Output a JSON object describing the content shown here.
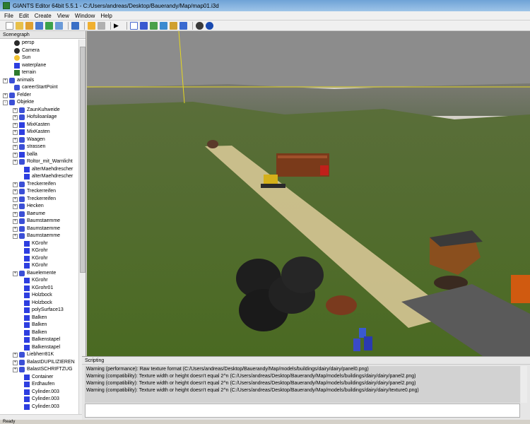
{
  "window": {
    "title": "GIANTS Editor 64bit 5.5.1 - C:/Users/andreas/Desktop/Bauerandy/Map/map01.i3d"
  },
  "menu": [
    "File",
    "Edit",
    "Create",
    "View",
    "Window",
    "Help"
  ],
  "scenegraph": {
    "header": "Scenegraph",
    "items": [
      {
        "label": "persp",
        "depth": 1,
        "icon": "camera-icon",
        "expander": ""
      },
      {
        "label": "Camera",
        "depth": 1,
        "icon": "camera-icon",
        "expander": ""
      },
      {
        "label": "Sun",
        "depth": 1,
        "icon": "sun-icon",
        "expander": ""
      },
      {
        "label": "waterplane",
        "depth": 1,
        "icon": "shape-icon",
        "expander": ""
      },
      {
        "label": "terrain",
        "depth": 1,
        "icon": "terrain-icon",
        "expander": ""
      },
      {
        "label": "animals",
        "depth": 0,
        "icon": "transform-group-icon",
        "expander": "+"
      },
      {
        "label": "careerStartPoint",
        "depth": 1,
        "icon": "transform-group-icon",
        "expander": ""
      },
      {
        "label": "Felder",
        "depth": 0,
        "icon": "transform-group-icon",
        "expander": "+"
      },
      {
        "label": "Objekte",
        "depth": 0,
        "icon": "transform-group-icon",
        "expander": "-"
      },
      {
        "label": "ZaunKuhweide",
        "depth": 2,
        "icon": "transform-group-icon",
        "expander": "+"
      },
      {
        "label": "Hofsiloanlage",
        "depth": 2,
        "icon": "transform-group-icon",
        "expander": "+"
      },
      {
        "label": "MixKasten",
        "depth": 2,
        "icon": "shape-icon",
        "expander": "+"
      },
      {
        "label": "MixKasten",
        "depth": 2,
        "icon": "shape-icon",
        "expander": "+"
      },
      {
        "label": "Waagen",
        "depth": 2,
        "icon": "transform-group-icon",
        "expander": "+"
      },
      {
        "label": "strassen",
        "depth": 2,
        "icon": "transform-group-icon",
        "expander": "+"
      },
      {
        "label": "balla",
        "depth": 2,
        "icon": "shape-icon",
        "expander": "+"
      },
      {
        "label": "Roltor_mit_Warnlicht",
        "depth": 2,
        "icon": "transform-group-icon",
        "expander": "+"
      },
      {
        "label": "alterMaehdrescher",
        "depth": 3,
        "icon": "shape-icon",
        "expander": ""
      },
      {
        "label": "alterMaehdrescher",
        "depth": 3,
        "icon": "shape-icon",
        "expander": ""
      },
      {
        "label": "Treckerreifen",
        "depth": 2,
        "icon": "transform-group-icon",
        "expander": "+"
      },
      {
        "label": "Treckerreifen",
        "depth": 2,
        "icon": "transform-group-icon",
        "expander": "+"
      },
      {
        "label": "Treckerreifen",
        "depth": 2,
        "icon": "transform-group-icon",
        "expander": "+"
      },
      {
        "label": "Hecken",
        "depth": 2,
        "icon": "transform-group-icon",
        "expander": "+"
      },
      {
        "label": "Baeume",
        "depth": 2,
        "icon": "transform-group-icon",
        "expander": "+"
      },
      {
        "label": "Baumstaemme",
        "depth": 2,
        "icon": "transform-group-icon",
        "expander": "+"
      },
      {
        "label": "Baumstaemme",
        "depth": 2,
        "icon": "transform-group-icon",
        "expander": "+"
      },
      {
        "label": "Baumstaemme",
        "depth": 2,
        "icon": "transform-group-icon",
        "expander": "+"
      },
      {
        "label": "KGrohr",
        "depth": 3,
        "icon": "shape-icon",
        "expander": ""
      },
      {
        "label": "KGrohr",
        "depth": 3,
        "icon": "shape-icon",
        "expander": ""
      },
      {
        "label": "KGrohr",
        "depth": 3,
        "icon": "shape-icon",
        "expander": ""
      },
      {
        "label": "KGrohr",
        "depth": 3,
        "icon": "shape-icon",
        "expander": ""
      },
      {
        "label": "Bauelemente",
        "depth": 2,
        "icon": "transform-group-icon",
        "expander": "+"
      },
      {
        "label": "KGrohr",
        "depth": 3,
        "icon": "shape-icon",
        "expander": ""
      },
      {
        "label": "KGrohr01",
        "depth": 3,
        "icon": "shape-icon",
        "expander": ""
      },
      {
        "label": "Holzbock",
        "depth": 3,
        "icon": "shape-icon",
        "expander": ""
      },
      {
        "label": "Holzbock",
        "depth": 3,
        "icon": "shape-icon",
        "expander": ""
      },
      {
        "label": "polySurface13",
        "depth": 3,
        "icon": "shape-icon",
        "expander": ""
      },
      {
        "label": "Balken",
        "depth": 3,
        "icon": "shape-icon",
        "expander": ""
      },
      {
        "label": "Balken",
        "depth": 3,
        "icon": "shape-icon",
        "expander": ""
      },
      {
        "label": "Balken",
        "depth": 3,
        "icon": "shape-icon",
        "expander": ""
      },
      {
        "label": "Balkenstapel",
        "depth": 3,
        "icon": "shape-icon",
        "expander": ""
      },
      {
        "label": "Balkenstapel",
        "depth": 3,
        "icon": "shape-icon",
        "expander": ""
      },
      {
        "label": "Liebherr81K",
        "depth": 2,
        "icon": "transform-group-icon",
        "expander": "+"
      },
      {
        "label": "BalastDUPILIZIEREN",
        "depth": 2,
        "icon": "transform-group-icon",
        "expander": "+"
      },
      {
        "label": "BalastSCHRIFTZUG",
        "depth": 2,
        "icon": "transform-group-icon",
        "expander": "+"
      },
      {
        "label": "Container",
        "depth": 3,
        "icon": "shape-icon",
        "expander": ""
      },
      {
        "label": "Erdhaufen",
        "depth": 3,
        "icon": "shape-icon",
        "expander": ""
      },
      {
        "label": "Cylinder.003",
        "depth": 3,
        "icon": "shape-icon",
        "expander": ""
      },
      {
        "label": "Cylinder.003",
        "depth": 3,
        "icon": "shape-icon",
        "expander": ""
      },
      {
        "label": "Cylinder.003",
        "depth": 3,
        "icon": "shape-icon",
        "expander": ""
      }
    ]
  },
  "scripting": {
    "header": "Scripting",
    "log": [
      "Warning (performance): Raw texture format (C:/Users/andreas/Desktop/Bauerandy/Map/models/buildings/dairy/dairy/panel0.png)",
      "Warning (compatibility): Texture width or height doesn't equal 2^n (C:/Users/andreas/Desktop/Bauerandy/Map/models/buildings/dairy/dairy/panel2.png)",
      "Warning (compatibility): Texture width or height doesn't equal 2^n (C:/Users/andreas/Desktop/Bauerandy/Map/models/buildings/dairy/dairy/panel2.png)",
      "Warning (compatibility): Texture width or height doesn't equal 2^n (C:/Users/andreas/Desktop/Bauerandy/Map/models/buildings/dairy/dairy/texture0.png)"
    ]
  },
  "status": {
    "text": "Ready"
  },
  "colors": {
    "sky": "#8a8a8a",
    "grass": "#4a6a28",
    "sand": "#d8c99a",
    "selection_line": "#e6d820"
  }
}
